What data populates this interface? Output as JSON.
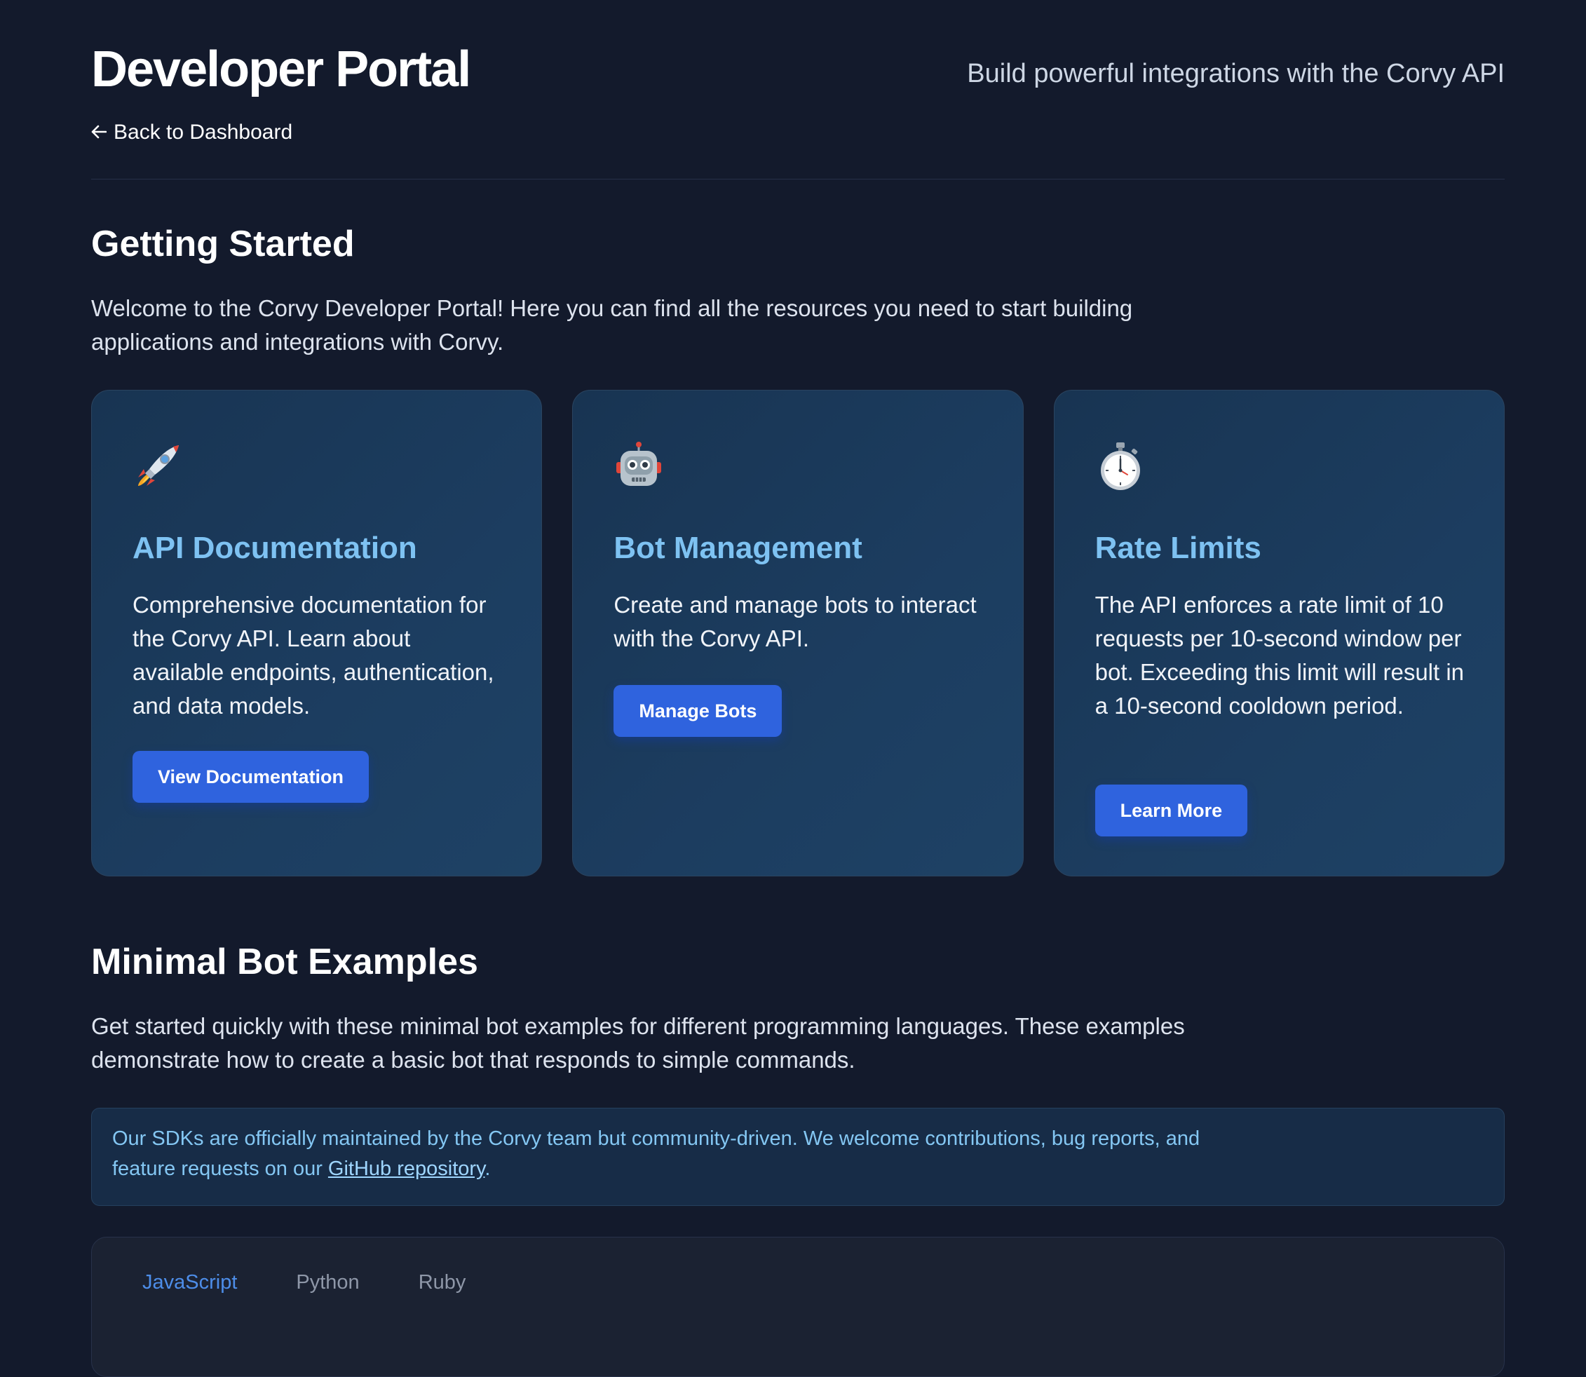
{
  "header": {
    "title": "Developer Portal",
    "tagline": "Build powerful integrations with the Corvy API",
    "back_label": "Back to Dashboard"
  },
  "getting_started": {
    "title": "Getting Started",
    "intro": "Welcome to the Corvy Developer Portal! Here you can find all the resources you need to start building applications and integrations with Corvy."
  },
  "cards": [
    {
      "icon": "rocket-icon",
      "title": "API Documentation",
      "text": "Comprehensive documentation for the Corvy API. Learn about available endpoints, authentication, and data models.",
      "button": "View Documentation"
    },
    {
      "icon": "robot-icon",
      "title": "Bot Management",
      "text": "Create and manage bots to interact with the Corvy API.",
      "button": "Manage Bots"
    },
    {
      "icon": "stopwatch-icon",
      "title": "Rate Limits",
      "text": "The API enforces a rate limit of 10 requests per 10-second window per bot. Exceeding this limit will result in a 10-second cooldown period.",
      "button": "Learn More"
    }
  ],
  "examples": {
    "title": "Minimal Bot Examples",
    "intro": "Get started quickly with these minimal bot examples for different programming languages. These examples demonstrate how to create a basic bot that responds to simple commands.",
    "notice_prefix": "Our SDKs are officially maintained by the Corvy team but community-driven. We welcome contributions, bug reports, and feature requests on our ",
    "notice_link": "GitHub repository",
    "notice_suffix": ".",
    "tabs": [
      {
        "label": "JavaScript",
        "active": true
      },
      {
        "label": "Python",
        "active": false
      },
      {
        "label": "Ruby",
        "active": false
      }
    ]
  },
  "colors": {
    "background": "#131a2c",
    "card_title": "#7ec2f2",
    "button": "#2f63de",
    "active_tab": "#4d8de8"
  }
}
